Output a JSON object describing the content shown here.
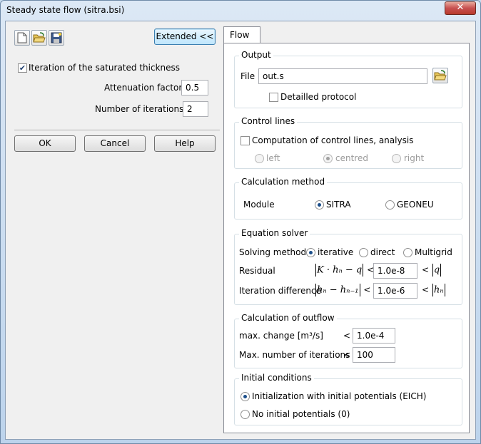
{
  "window": {
    "title": "Steady state flow (sitra.bsi)",
    "close_label": "✕"
  },
  "toolbar": {
    "new_icon": "new-document-icon",
    "open_icon": "open-folder-icon",
    "save_icon": "save-disk-icon",
    "extended_label": "Extended <<"
  },
  "left": {
    "iteration_checkbox_label": "Iteration of the saturated thickness",
    "iteration_checked": true,
    "attenuation_label": "Attenuation factor",
    "attenuation_value": "0.5",
    "iterations_label": "Number of iterations",
    "iterations_value": "2"
  },
  "buttons": {
    "ok": "OK",
    "cancel": "Cancel",
    "help": "Help"
  },
  "tabs": [
    {
      "label": "Flow",
      "selected": true
    }
  ],
  "output": {
    "title": "Output",
    "file_label": "File",
    "file_value": "out.s",
    "browse_icon": "open-folder-icon",
    "detailed_label": "Detailled protocol",
    "detailed_checked": false
  },
  "control_lines": {
    "title": "Control lines",
    "compute_label": "Computation of control lines, analysis",
    "compute_checked": false,
    "options": [
      {
        "label": "left",
        "selected": false
      },
      {
        "label": "centred",
        "selected": true
      },
      {
        "label": "right",
        "selected": false
      }
    ]
  },
  "calculation_method": {
    "title": "Calculation method",
    "module_label": "Module",
    "options": [
      {
        "label": "SITRA",
        "selected": true
      },
      {
        "label": "GEONEU",
        "selected": false
      }
    ]
  },
  "equation_solver": {
    "title": "Equation solver",
    "solving_label": "Solving method",
    "options": [
      {
        "label": "iterative",
        "selected": true
      },
      {
        "label": "direct",
        "selected": false
      },
      {
        "label": "Multigrid",
        "selected": false
      }
    ],
    "residual_label": "Residual",
    "residual_lhs": "K · hₙ − q",
    "residual_value": "1.0e-8",
    "residual_rhs": "q",
    "iter_diff_label": "Iteration difference",
    "iter_diff_lhs": "hₙ − hₙ₋₁",
    "iter_diff_value": "1.0e-6",
    "iter_diff_rhs": "hₙ",
    "less_than": "<"
  },
  "outflow": {
    "title": "Calculation of outflow",
    "max_change_label": "max. change [m³/s]",
    "max_change_value": "1.0e-4",
    "max_iter_label": "Max. number of iterations",
    "max_iter_value": "100",
    "less_than": "<"
  },
  "initial_conditions": {
    "title": "Initial conditions",
    "options": [
      {
        "label": "Initialization with initial potentials (EICH)",
        "selected": true
      },
      {
        "label": "No initial potentials (0)",
        "selected": false
      }
    ]
  }
}
